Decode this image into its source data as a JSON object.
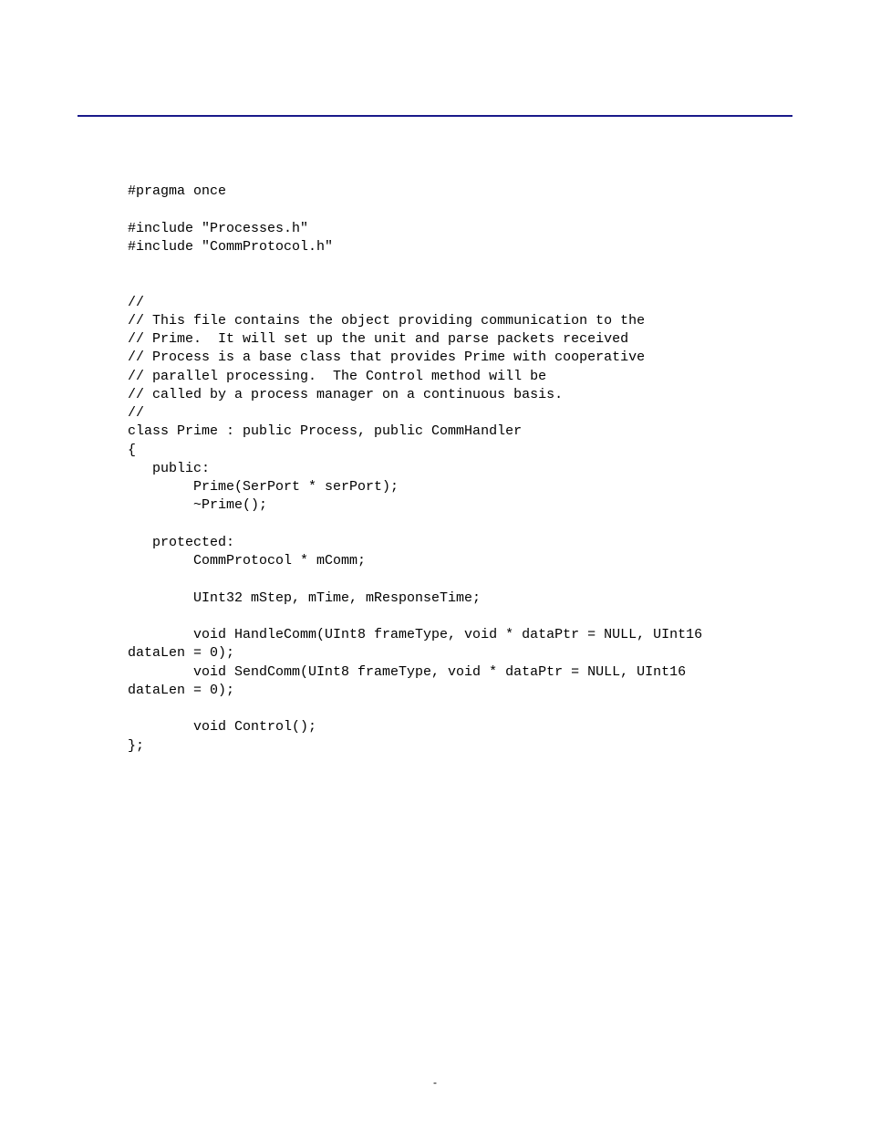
{
  "code": {
    "lines": [
      "#pragma once",
      "",
      "#include \"Processes.h\"",
      "#include \"CommProtocol.h\"",
      "",
      "",
      "//",
      "// This file contains the object providing communication to the",
      "// Prime.  It will set up the unit and parse packets received",
      "// Process is a base class that provides Prime with cooperative",
      "// parallel processing.  The Control method will be",
      "// called by a process manager on a continuous basis.",
      "//",
      "class Prime : public Process, public CommHandler",
      "{",
      "   public:",
      "        Prime(SerPort * serPort);",
      "        ~Prime();",
      "",
      "   protected:",
      "        CommProtocol * mComm;",
      "",
      "        UInt32 mStep, mTime, mResponseTime;",
      "",
      "        void HandleComm(UInt8 frameType, void * dataPtr = NULL, UInt16",
      "dataLen = 0);",
      "        void SendComm(UInt8 frameType, void * dataPtr = NULL, UInt16",
      "dataLen = 0);",
      "",
      "        void Control();",
      "};"
    ]
  },
  "footer": {
    "dash": "-"
  }
}
